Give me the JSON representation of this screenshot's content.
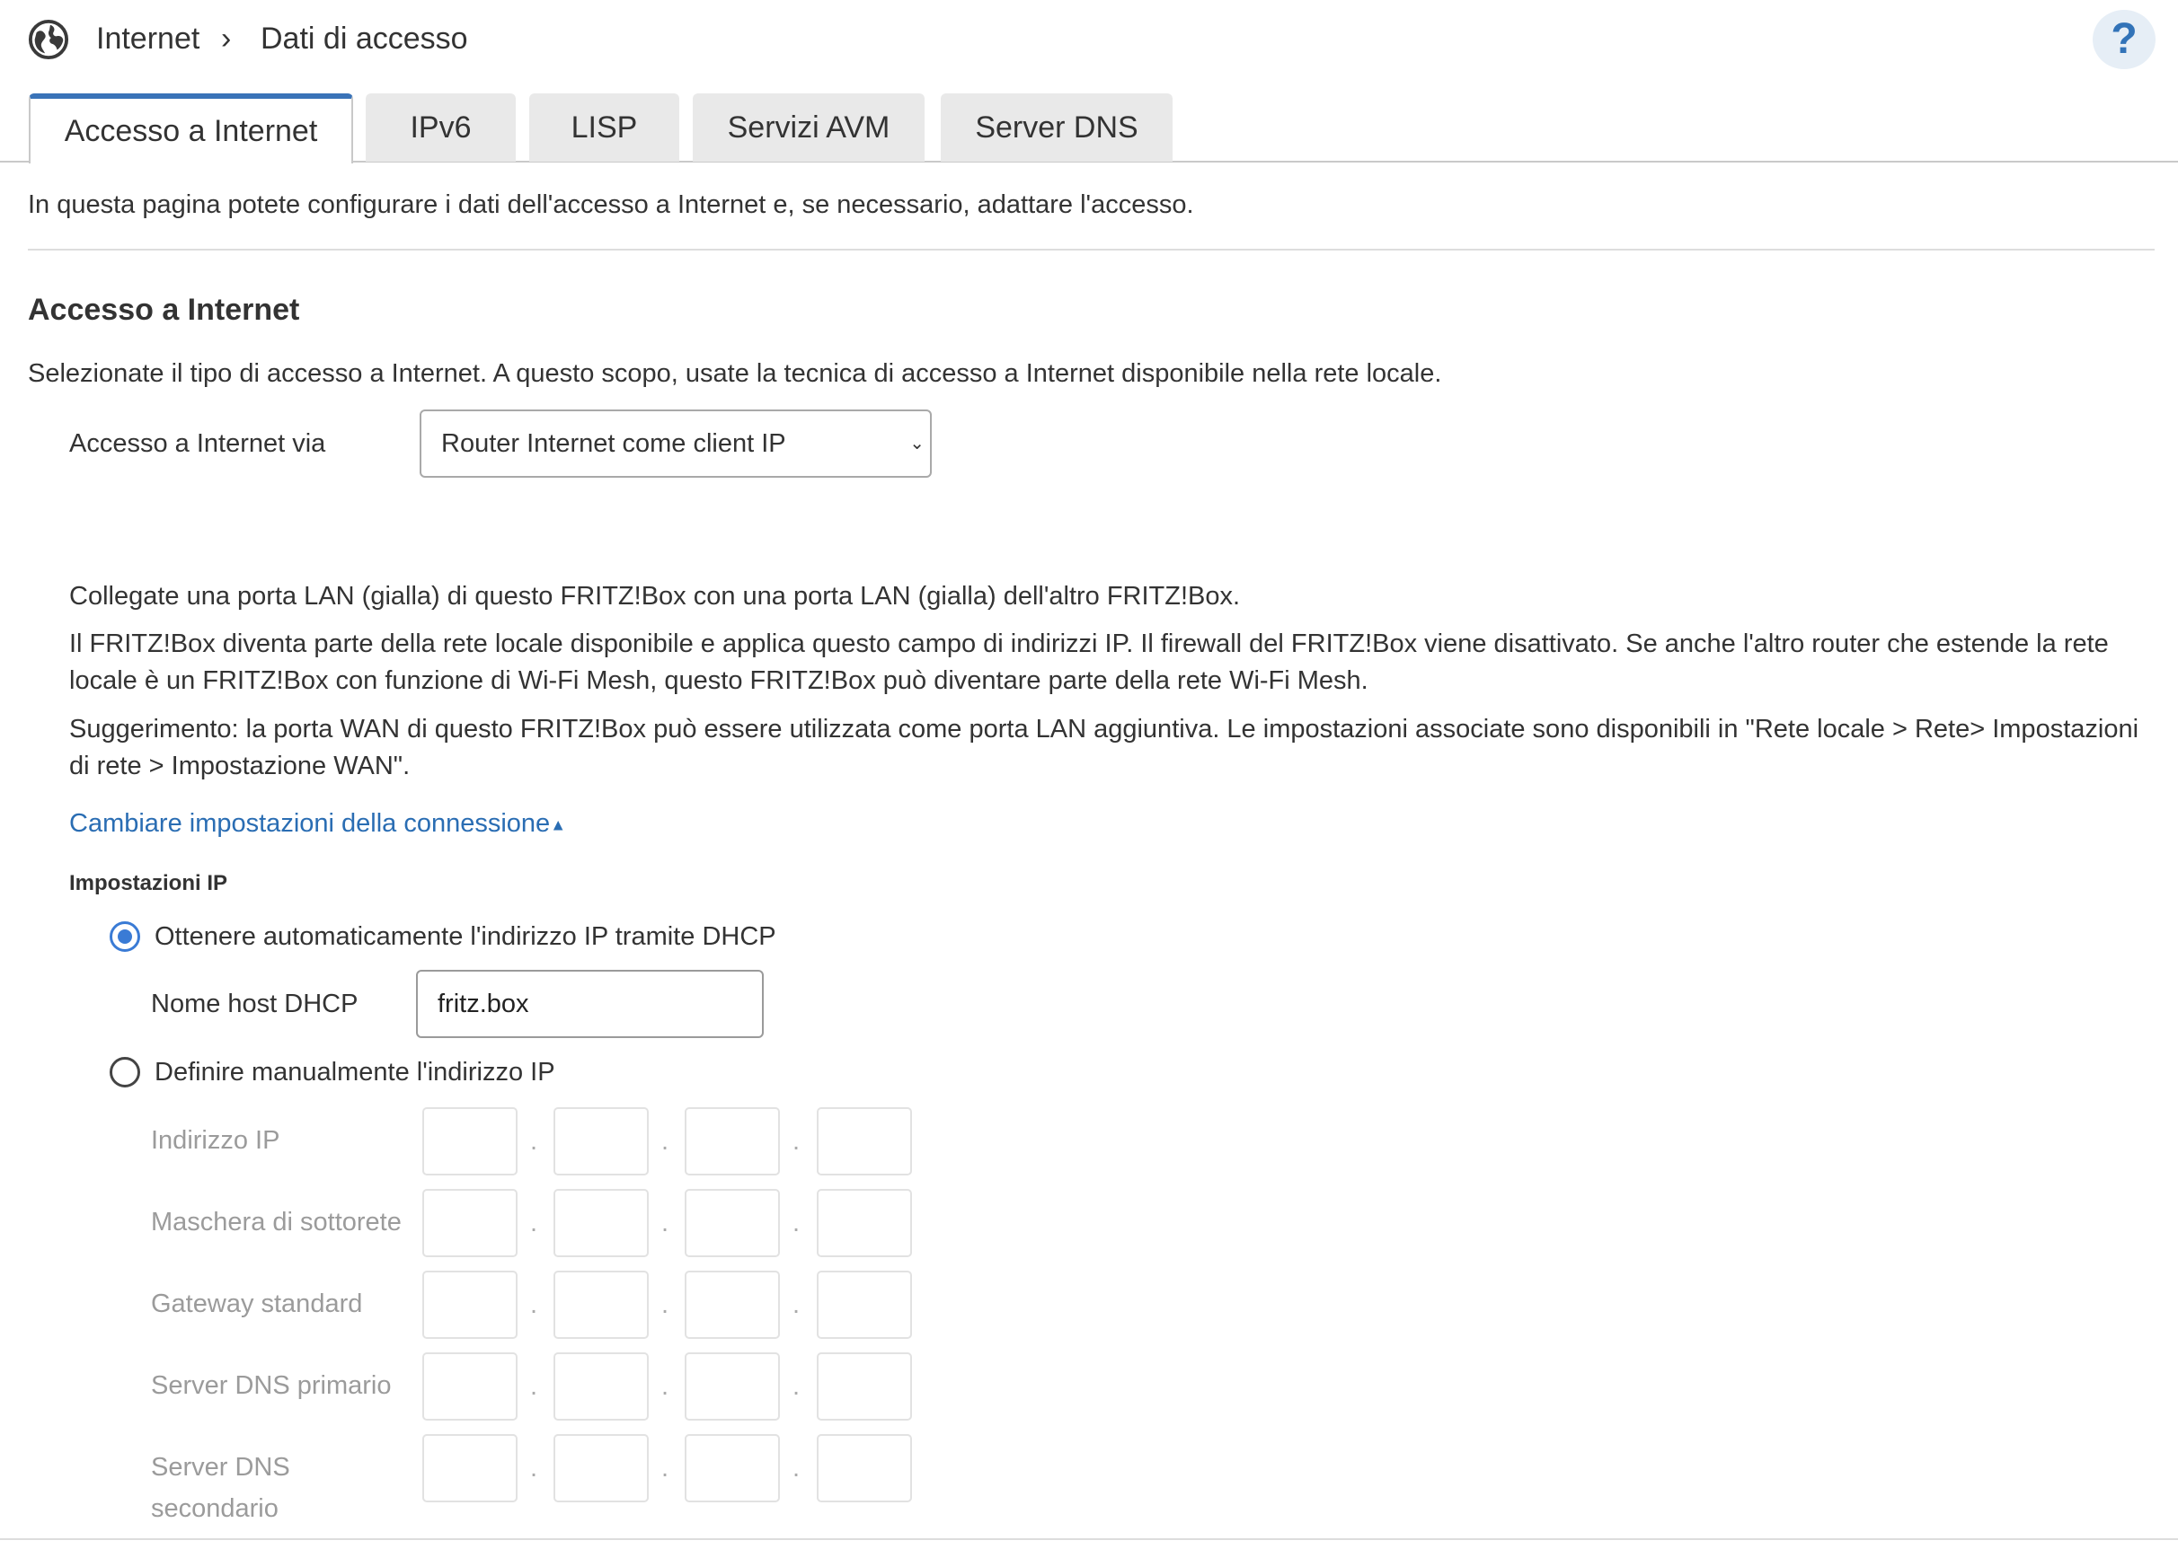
{
  "header": {
    "breadcrumb": [
      "Internet",
      "Dati di accesso"
    ],
    "help_label": "?"
  },
  "tabs": [
    {
      "label": "Accesso a Internet",
      "active": true
    },
    {
      "label": "IPv6",
      "active": false
    },
    {
      "label": "LISP",
      "active": false
    },
    {
      "label": "Servizi AVM",
      "active": false
    },
    {
      "label": "Server DNS",
      "active": false
    }
  ],
  "intro": "In questa pagina potete configurare i dati dell'accesso a Internet e, se necessario, adattare l'accesso.",
  "section": {
    "title": "Accesso a Internet",
    "description": "Selezionate il tipo di accesso a Internet. A questo scopo, usate la tecnica di accesso a Internet disponibile nella rete locale.",
    "access_label": "Accesso a Internet via",
    "access_value": "Router Internet come client IP"
  },
  "info": {
    "p1": "Collegate una porta LAN (gialla) di questo FRITZ!Box con una porta LAN (gialla) dell'altro FRITZ!Box.",
    "p2_line1": "Il FRITZ!Box diventa parte della rete locale disponibile e applica questo campo di indirizzi IP. Il firewall del FRITZ!Box viene disattivato. Se anche l'altro router che estende la rete",
    "p2_line2": "locale è un FRITZ!Box con funzione di Wi-Fi Mesh, questo FRITZ!Box può diventare parte della rete Wi-Fi Mesh.",
    "p3_line1": "Suggerimento: la porta WAN di questo FRITZ!Box può essere utilizzata come porta LAN aggiuntiva. Le impostazioni associate sono disponibili in \"Rete locale > Rete> Impostazioni",
    "p3_line2": "di rete > Impostazione WAN\".",
    "toggle_link": "Cambiare impostazioni della connessione"
  },
  "ip_settings": {
    "title": "Impostazioni IP",
    "dhcp_option": "Ottenere automaticamente l'indirizzo IP tramite DHCP",
    "dhcp_selected": true,
    "hostname_label": "Nome host DHCP",
    "hostname_value": "fritz.box",
    "manual_option": "Definire manualmente l'indirizzo IP",
    "manual_fields": [
      {
        "label": "Indirizzo IP"
      },
      {
        "label": "Maschera di sottorete"
      },
      {
        "label": "Gateway standard"
      },
      {
        "label": "Server DNS primario"
      },
      {
        "label_line1": "Server DNS",
        "label_line2": "secondario"
      }
    ],
    "separator": "."
  }
}
